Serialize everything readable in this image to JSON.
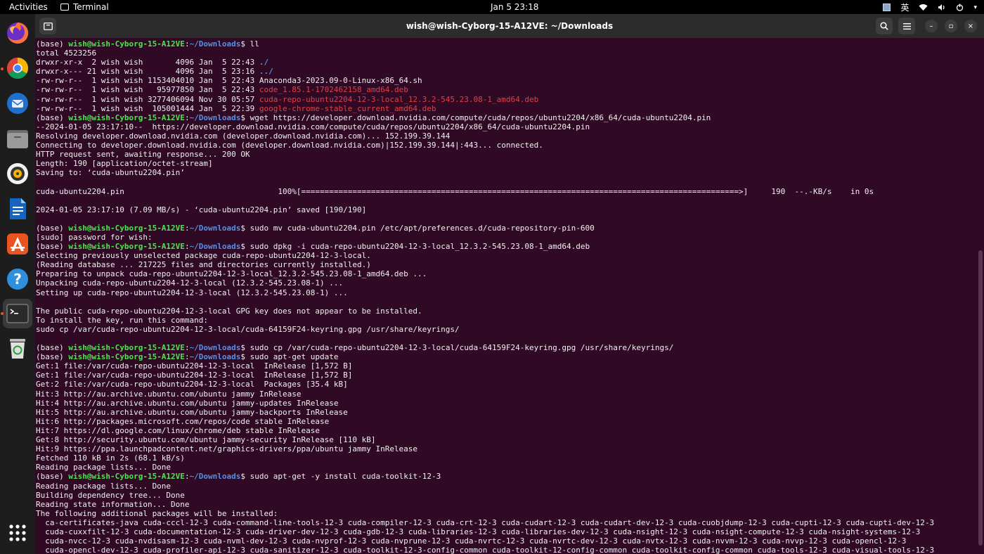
{
  "topbar": {
    "activities": "Activities",
    "app_name": "Terminal",
    "clock": "Jan 5  23:18",
    "ime": "英",
    "icons": [
      "ime-indicator-icon",
      "wifi-icon",
      "volume-icon",
      "power-icon"
    ]
  },
  "dock": {
    "items": [
      {
        "name": "firefox",
        "icon": "firefox-icon"
      },
      {
        "name": "chrome",
        "icon": "chrome-icon"
      },
      {
        "name": "thunderbird",
        "icon": "thunderbird-icon"
      },
      {
        "name": "files",
        "icon": "files-icon"
      },
      {
        "name": "rhythmbox",
        "icon": "rhythmbox-icon"
      },
      {
        "name": "writer",
        "icon": "writer-icon"
      },
      {
        "name": "software",
        "icon": "software-store-icon"
      },
      {
        "name": "help",
        "icon": "help-icon"
      },
      {
        "name": "terminal",
        "icon": "terminal-icon",
        "active": true
      },
      {
        "name": "trash",
        "icon": "trash-icon"
      },
      {
        "name": "show-apps",
        "icon": "app-grid-icon"
      }
    ]
  },
  "window": {
    "title": "wish@wish-Cyborg-15-A12VE: ~/Downloads",
    "buttons": {
      "new_tab": "new-tab-icon",
      "search": "search-icon",
      "menu": "hamburger-menu-icon",
      "minimize": "–",
      "maximize": "▫",
      "close": "×"
    }
  },
  "prompt": {
    "env": "(base) ",
    "user_host": "wish@wish-Cyborg-15-A12VE",
    "sep": ":",
    "path": "~/Downloads",
    "dollar": "$ "
  },
  "terminal_lines": [
    {
      "t": "prompt",
      "cmd": "ll"
    },
    {
      "t": "out",
      "text": "total 4523256"
    },
    {
      "t": "ls",
      "meta": "drwxr-xr-x  2 wish wish       4096 Jan  5 22:43 ",
      "name": "./",
      "cls": "c-blue"
    },
    {
      "t": "ls",
      "meta": "drwxr-x--- 21 wish wish       4096 Jan  5 23:16 ",
      "name": "../",
      "cls": "c-blue"
    },
    {
      "t": "ls",
      "meta": "-rw-rw-r--  1 wish wish 1153404010 Jan  5 22:43 ",
      "name": "Anaconda3-2023.09-0-Linux-x86_64.sh",
      "cls": ""
    },
    {
      "t": "ls",
      "meta": "-rw-rw-r--  1 wish wish   95977850 Jan  5 22:43 ",
      "name": "code_1.85.1-1702462158_amd64.deb",
      "cls": "c-red"
    },
    {
      "t": "ls",
      "meta": "-rw-rw-r--  1 wish wish 3277406094 Nov 30 05:57 ",
      "name": "cuda-repo-ubuntu2204-12-3-local_12.3.2-545.23.08-1_amd64.deb",
      "cls": "c-red"
    },
    {
      "t": "ls",
      "meta": "-rw-rw-r--  1 wish wish  105001444 Jan  5 22:39 ",
      "name": "google-chrome-stable_current_amd64.deb",
      "cls": "c-red"
    },
    {
      "t": "prompt",
      "cmd": "wget https://developer.download.nvidia.com/compute/cuda/repos/ubuntu2204/x86_64/cuda-ubuntu2204.pin"
    },
    {
      "t": "out",
      "text": "--2024-01-05 23:17:10--  https://developer.download.nvidia.com/compute/cuda/repos/ubuntu2204/x86_64/cuda-ubuntu2204.pin"
    },
    {
      "t": "out",
      "text": "Resolving developer.download.nvidia.com (developer.download.nvidia.com)... 152.199.39.144"
    },
    {
      "t": "out",
      "text": "Connecting to developer.download.nvidia.com (developer.download.nvidia.com)|152.199.39.144|:443... connected."
    },
    {
      "t": "out",
      "text": "HTTP request sent, awaiting response... 200 OK"
    },
    {
      "t": "out",
      "text": "Length: 190 [application/octet-stream]"
    },
    {
      "t": "out",
      "text": "Saving to: ‘cuda-ubuntu2204.pin’"
    },
    {
      "t": "out",
      "text": ""
    },
    {
      "t": "out",
      "text": "cuda-ubuntu2204.pin                                 100%[==============================================================================================>]     190  --.-KB/s    in 0s"
    },
    {
      "t": "out",
      "text": ""
    },
    {
      "t": "out",
      "text": "2024-01-05 23:17:10 (7.09 MB/s) - ‘cuda-ubuntu2204.pin’ saved [190/190]"
    },
    {
      "t": "out",
      "text": ""
    },
    {
      "t": "prompt",
      "cmd": "sudo mv cuda-ubuntu2204.pin /etc/apt/preferences.d/cuda-repository-pin-600"
    },
    {
      "t": "out",
      "text": "[sudo] password for wish:"
    },
    {
      "t": "prompt",
      "cmd": "sudo dpkg -i cuda-repo-ubuntu2204-12-3-local_12.3.2-545.23.08-1_amd64.deb"
    },
    {
      "t": "out",
      "text": "Selecting previously unselected package cuda-repo-ubuntu2204-12-3-local."
    },
    {
      "t": "out",
      "text": "(Reading database ... 217225 files and directories currently installed.)"
    },
    {
      "t": "out",
      "text": "Preparing to unpack cuda-repo-ubuntu2204-12-3-local_12.3.2-545.23.08-1_amd64.deb ..."
    },
    {
      "t": "out",
      "text": "Unpacking cuda-repo-ubuntu2204-12-3-local (12.3.2-545.23.08-1) ..."
    },
    {
      "t": "out",
      "text": "Setting up cuda-repo-ubuntu2204-12-3-local (12.3.2-545.23.08-1) ..."
    },
    {
      "t": "out",
      "text": ""
    },
    {
      "t": "out",
      "text": "The public cuda-repo-ubuntu2204-12-3-local GPG key does not appear to be installed."
    },
    {
      "t": "out",
      "text": "To install the key, run this command:"
    },
    {
      "t": "out",
      "text": "sudo cp /var/cuda-repo-ubuntu2204-12-3-local/cuda-64159F24-keyring.gpg /usr/share/keyrings/"
    },
    {
      "t": "out",
      "text": ""
    },
    {
      "t": "prompt",
      "cmd": "sudo cp /var/cuda-repo-ubuntu2204-12-3-local/cuda-64159F24-keyring.gpg /usr/share/keyrings/"
    },
    {
      "t": "prompt",
      "cmd": "sudo apt-get update"
    },
    {
      "t": "out",
      "text": "Get:1 file:/var/cuda-repo-ubuntu2204-12-3-local  InRelease [1,572 B]"
    },
    {
      "t": "out",
      "text": "Get:1 file:/var/cuda-repo-ubuntu2204-12-3-local  InRelease [1,572 B]"
    },
    {
      "t": "out",
      "text": "Get:2 file:/var/cuda-repo-ubuntu2204-12-3-local  Packages [35.4 kB]"
    },
    {
      "t": "out",
      "text": "Hit:3 http://au.archive.ubuntu.com/ubuntu jammy InRelease"
    },
    {
      "t": "out",
      "text": "Hit:4 http://au.archive.ubuntu.com/ubuntu jammy-updates InRelease"
    },
    {
      "t": "out",
      "text": "Hit:5 http://au.archive.ubuntu.com/ubuntu jammy-backports InRelease"
    },
    {
      "t": "out",
      "text": "Hit:6 http://packages.microsoft.com/repos/code stable InRelease"
    },
    {
      "t": "out",
      "text": "Hit:7 https://dl.google.com/linux/chrome/deb stable InRelease"
    },
    {
      "t": "out",
      "text": "Get:8 http://security.ubuntu.com/ubuntu jammy-security InRelease [110 kB]"
    },
    {
      "t": "out",
      "text": "Hit:9 https://ppa.launchpadcontent.net/graphics-drivers/ppa/ubuntu jammy InRelease"
    },
    {
      "t": "out",
      "text": "Fetched 110 kB in 2s (68.1 kB/s)"
    },
    {
      "t": "out",
      "text": "Reading package lists... Done"
    },
    {
      "t": "prompt",
      "cmd": "sudo apt-get -y install cuda-toolkit-12-3"
    },
    {
      "t": "out",
      "text": "Reading package lists... Done"
    },
    {
      "t": "out",
      "text": "Building dependency tree... Done"
    },
    {
      "t": "out",
      "text": "Reading state information... Done"
    },
    {
      "t": "out",
      "text": "The following additional packages will be installed:"
    },
    {
      "t": "out",
      "text": "  ca-certificates-java cuda-cccl-12-3 cuda-command-line-tools-12-3 cuda-compiler-12-3 cuda-crt-12-3 cuda-cudart-12-3 cuda-cudart-dev-12-3 cuda-cuobjdump-12-3 cuda-cupti-12-3 cuda-cupti-dev-12-3"
    },
    {
      "t": "out",
      "text": "  cuda-cuxxfilt-12-3 cuda-documentation-12-3 cuda-driver-dev-12-3 cuda-gdb-12-3 cuda-libraries-12-3 cuda-libraries-dev-12-3 cuda-nsight-12-3 cuda-nsight-compute-12-3 cuda-nsight-systems-12-3"
    },
    {
      "t": "out",
      "text": "  cuda-nvcc-12-3 cuda-nvdisasm-12-3 cuda-nvml-dev-12-3 cuda-nvprof-12-3 cuda-nvprune-12-3 cuda-nvrtc-12-3 cuda-nvrtc-dev-12-3 cuda-nvtx-12-3 cuda-nvvm-12-3 cuda-nvvp-12-3 cuda-opencl-12-3"
    },
    {
      "t": "out",
      "text": "  cuda-opencl-dev-12-3 cuda-profiler-api-12-3 cuda-sanitizer-12-3 cuda-toolkit-12-3-config-common cuda-toolkit-12-config-common cuda-toolkit-config-common cuda-tools-12-3 cuda-visual-tools-12-3"
    }
  ]
}
